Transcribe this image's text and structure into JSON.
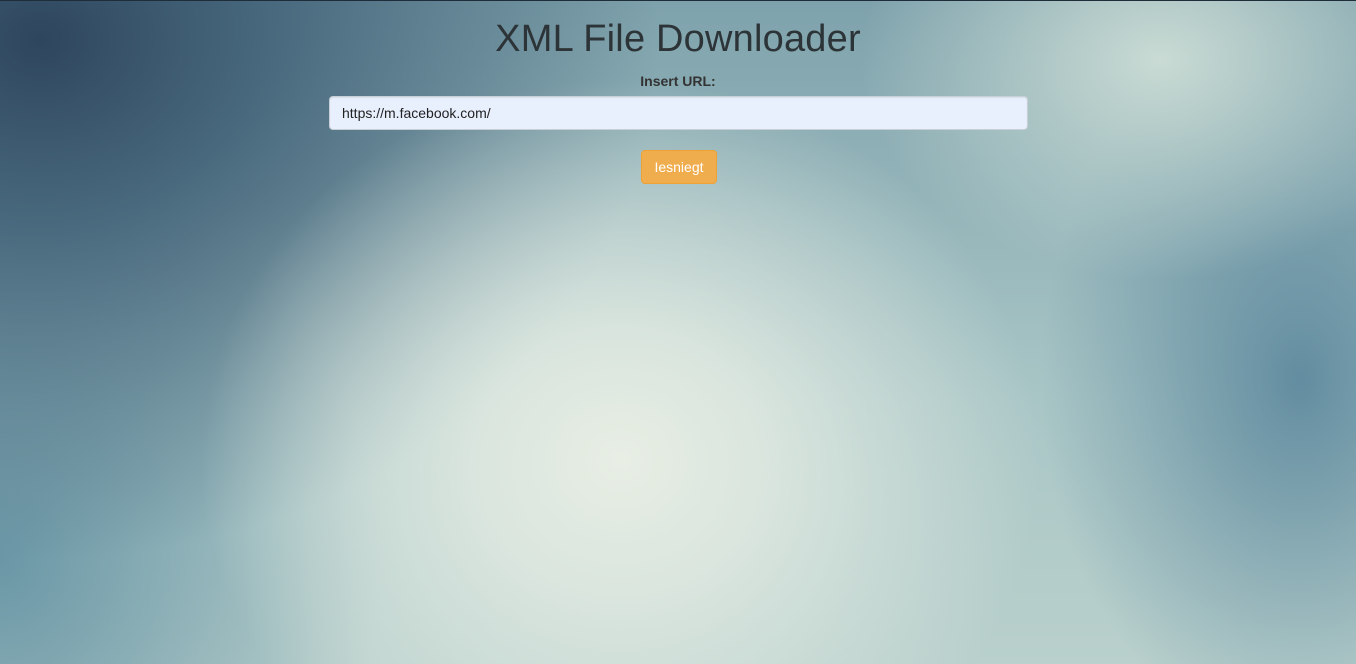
{
  "page": {
    "title": "XML File Downloader"
  },
  "form": {
    "url_label": "Insert URL:",
    "url_value": "https://m.facebook.com/",
    "submit_label": "Iesniegt"
  },
  "colors": {
    "button": "#f0ad4e",
    "input_bg": "#e8f0fe",
    "title_text": "#2d3438"
  }
}
